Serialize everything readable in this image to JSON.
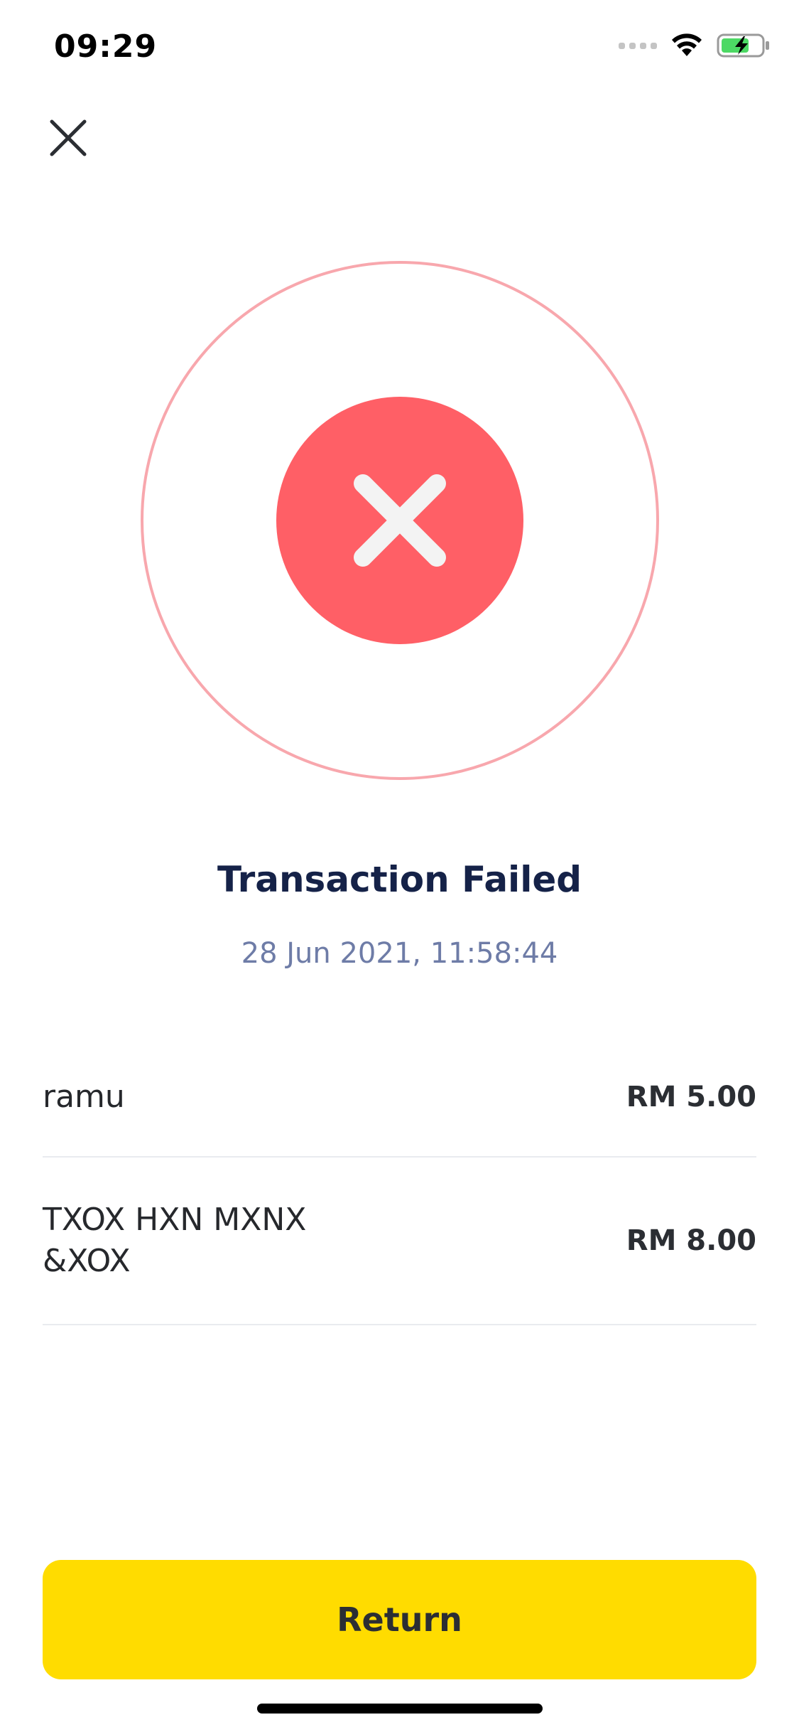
{
  "status_bar": {
    "time": "09:29",
    "icons": [
      "signal-dots-icon",
      "wifi-icon",
      "battery-charging-icon"
    ],
    "battery_color": "#4cd964"
  },
  "header": {
    "close_icon": "close-icon"
  },
  "result": {
    "title": "Transaction Failed",
    "timestamp": "28 Jun 2021, 11:58:44",
    "status_icon": "x-icon",
    "status_color": "#ff5f66",
    "ring_color": "#f8a7ad"
  },
  "items": [
    {
      "name": "ramu",
      "price": "RM 5.00"
    },
    {
      "name": "TXOX HXN MXNX &XOX",
      "price": "RM 8.00"
    }
  ],
  "actions": {
    "return_label": "Return",
    "button_color": "#ffdc00"
  }
}
